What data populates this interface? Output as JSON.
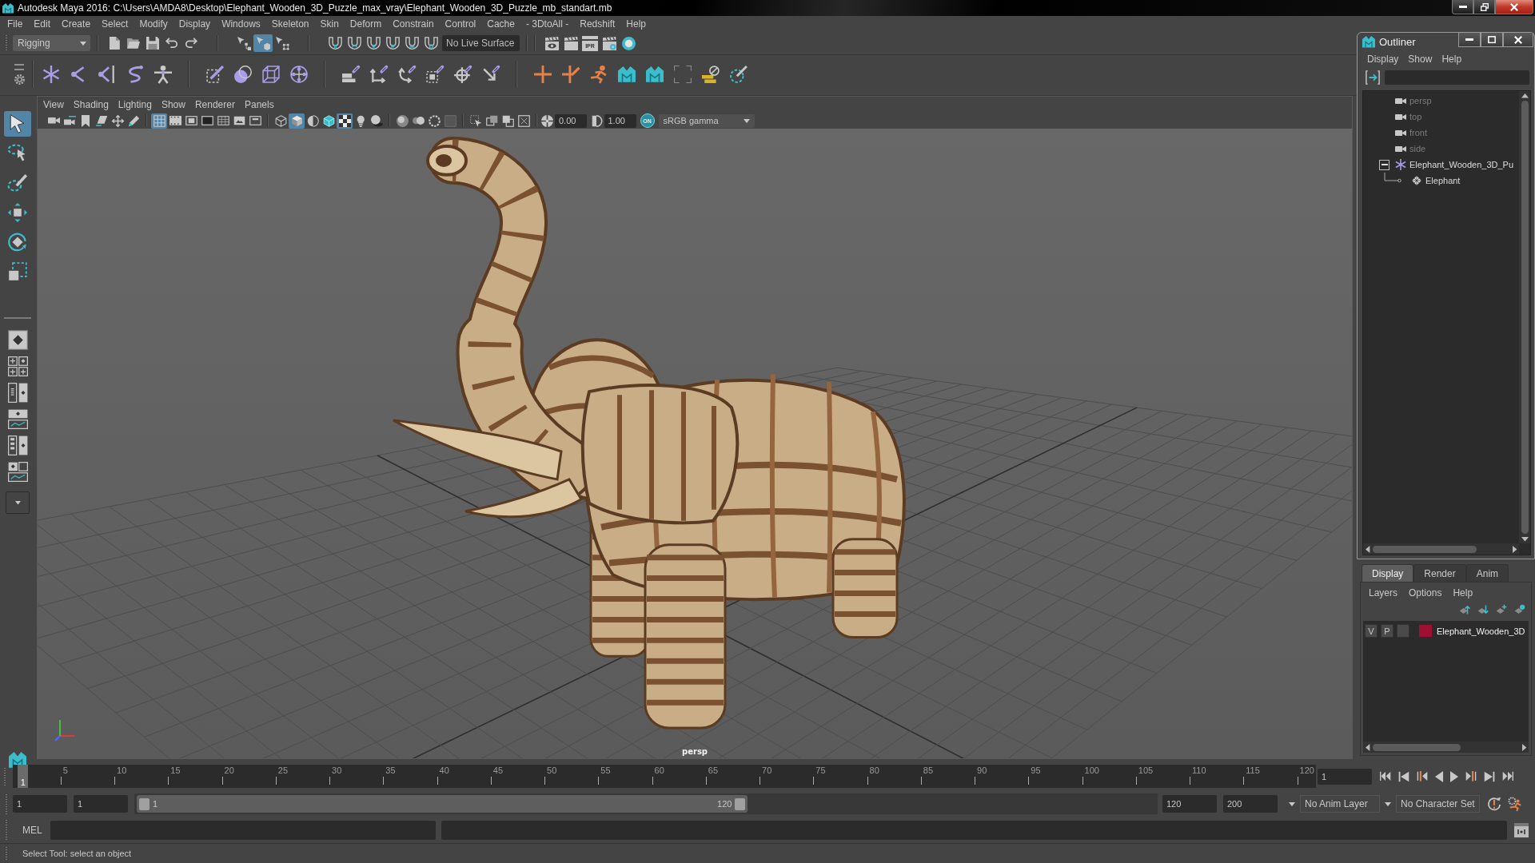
{
  "title_bar": {
    "title": "Autodesk Maya 2016: C:\\Users\\AMDA8\\Desktop\\Elephant_Wooden_3D_Puzzle_max_vray\\Elephant_Wooden_3D_Puzzle_mb_standart.mb"
  },
  "menu_bar": [
    "File",
    "Edit",
    "Create",
    "Select",
    "Modify",
    "Display",
    "Windows",
    "Skeleton",
    "Skin",
    "Deform",
    "Constrain",
    "Control",
    "Cache",
    "- 3DtoAll -",
    "Redshift",
    "Help"
  ],
  "status_line": {
    "menu_set": "Rigging",
    "selection_modes": [
      {
        "kind": "hierarchy",
        "selected": false
      },
      {
        "kind": "object",
        "selected": true
      },
      {
        "kind": "component",
        "selected": false
      }
    ],
    "live_surface": "No Live Surface",
    "ipr": "IPR"
  },
  "toolbox": {
    "tools": [
      {
        "kind": "select",
        "selected": true
      },
      {
        "kind": "lasso",
        "selected": false
      },
      {
        "kind": "paint",
        "selected": false
      },
      {
        "kind": "move",
        "selected": false
      },
      {
        "kind": "rotate",
        "selected": false
      },
      {
        "kind": "scale",
        "selected": false
      }
    ]
  },
  "viewport": {
    "menu": [
      "View",
      "Shading",
      "Lighting",
      "Show",
      "Renderer",
      "Panels"
    ],
    "toolbar": [
      [
        {
          "kind": "camera",
          "on": false
        },
        {
          "kind": "camattr",
          "on": false
        },
        {
          "kind": "bookmark",
          "on": false
        },
        {
          "kind": "imgplane",
          "on": false
        },
        {
          "kind": "pan",
          "on": false
        },
        {
          "kind": "pencil",
          "on": false
        }
      ],
      [
        {
          "kind": "grid",
          "on": true
        },
        {
          "kind": "film",
          "on": false
        },
        {
          "kind": "resgate",
          "on": false
        },
        {
          "kind": "gatemask",
          "on": false
        },
        {
          "kind": "fieldchart",
          "on": false
        },
        {
          "kind": "safeaction",
          "on": false
        },
        {
          "kind": "safetitle",
          "on": false
        }
      ],
      [
        {
          "kind": "wireframe",
          "on": false
        },
        {
          "kind": "smooth",
          "on": true
        },
        {
          "kind": "material",
          "on": false
        },
        {
          "kind": "wireshaded",
          "on": false
        },
        {
          "kind": "textured",
          "on": true
        },
        {
          "kind": "lights",
          "on": false
        },
        {
          "kind": "shadows",
          "on": false
        }
      ],
      [
        {
          "kind": "ssao",
          "on": false
        },
        {
          "kind": "motionblur",
          "on": false
        },
        {
          "kind": "antialias",
          "on": false
        },
        {
          "kind": "dof",
          "on": false
        }
      ],
      [
        {
          "kind": "isolate",
          "on": false
        },
        {
          "kind": "xray",
          "on": false
        },
        {
          "kind": "xrayjoints",
          "on": false
        },
        {
          "kind": "xraycomponents",
          "on": false
        }
      ]
    ],
    "exposure": "0.00",
    "gamma": "1.00",
    "color_management": {
      "label": "ON",
      "on": true
    },
    "color_space": "sRGB gamma",
    "camera": "persp"
  },
  "outliner": {
    "title": "Outliner",
    "menu": [
      "Display",
      "Show",
      "Help"
    ],
    "items": [
      {
        "label": "persp",
        "kind": "camera",
        "dimmed": true
      },
      {
        "label": "top",
        "kind": "camera",
        "dimmed": true
      },
      {
        "label": "front",
        "kind": "camera",
        "dimmed": true
      },
      {
        "label": "side",
        "kind": "camera",
        "dimmed": true
      },
      {
        "label": "Elephant_Wooden_3D_Pu",
        "kind": "joint",
        "dimmed": false,
        "expanded": true,
        "children": [
          {
            "label": "Elephant",
            "kind": "mesh",
            "dimmed": false
          }
        ]
      }
    ]
  },
  "layer_editor": {
    "tabs": [
      {
        "label": "Display",
        "selected": true
      },
      {
        "label": "Render",
        "selected": false
      },
      {
        "label": "Anim",
        "selected": false
      }
    ],
    "menu": [
      "Layers",
      "Options",
      "Help"
    ],
    "layers": [
      {
        "visibility": "V",
        "playback": "P",
        "color": "#9e0f32",
        "name": "Elephant_Wooden_3D"
      }
    ]
  },
  "time_slider": {
    "current_frame": "1",
    "ticks": [
      "5",
      "10",
      "15",
      "20",
      "25",
      "30",
      "35",
      "40",
      "45",
      "50",
      "55",
      "60",
      "65",
      "70",
      "75",
      "80",
      "85",
      "90",
      "95",
      "100",
      "105",
      "110",
      "115",
      "120"
    ],
    "frame_field": "1"
  },
  "range_slider": {
    "start": "1",
    "playback_start": "1",
    "range_start": "1",
    "range_end": "120",
    "level": 0.6,
    "playback_end": "120",
    "end": "200",
    "anim_layer": "No Anim Layer",
    "character_set": "No Character Set"
  },
  "command_line": {
    "language": "MEL"
  },
  "help_line": "Select Tool: select an object"
}
